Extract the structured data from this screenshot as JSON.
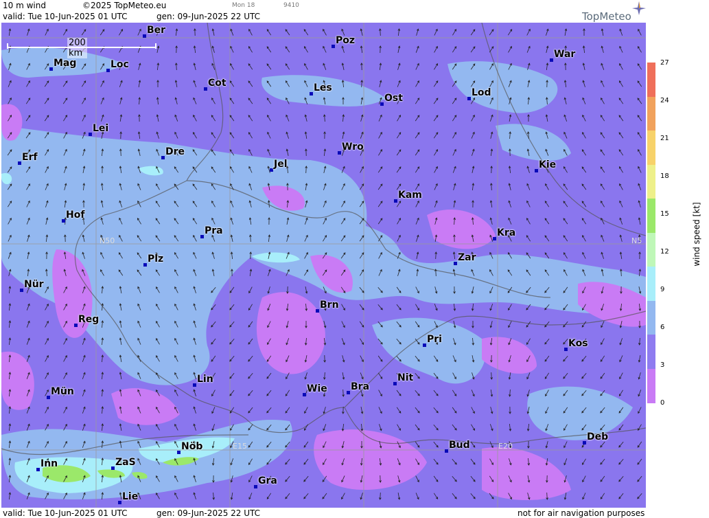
{
  "header": {
    "title": "10 m wind",
    "copyright": "©2025 TopMeteo.eu",
    "valid": "valid:  Tue  10-Jun-2025  01 UTC",
    "gen": "gen: 09-Jun-2025 22 UTC",
    "mon": "Mon 18",
    "code": "9410",
    "logo": "TopMeteo"
  },
  "map": {
    "scale_label": "200 km",
    "grid_labels": {
      "n50_left": "N50",
      "n50_right": "N5",
      "e15": "E15",
      "e20": "E20"
    },
    "cities": [
      {
        "name": "Ber"
      },
      {
        "name": "Poz"
      },
      {
        "name": "War"
      },
      {
        "name": "Mag"
      },
      {
        "name": "Loc"
      },
      {
        "name": "Cot"
      },
      {
        "name": "Les"
      },
      {
        "name": "Ost"
      },
      {
        "name": "Lod"
      },
      {
        "name": "Lei"
      },
      {
        "name": "Erf"
      },
      {
        "name": "Dre"
      },
      {
        "name": "Wro"
      },
      {
        "name": "Jel"
      },
      {
        "name": "Kie"
      },
      {
        "name": "Kam"
      },
      {
        "name": "Hof"
      },
      {
        "name": "Pra"
      },
      {
        "name": "Kra"
      },
      {
        "name": "Plz"
      },
      {
        "name": "Zar"
      },
      {
        "name": "Nür"
      },
      {
        "name": "Brn"
      },
      {
        "name": "Reg"
      },
      {
        "name": "Pri"
      },
      {
        "name": "Kos"
      },
      {
        "name": "Lin"
      },
      {
        "name": "Nit"
      },
      {
        "name": "Wie"
      },
      {
        "name": "Bra"
      },
      {
        "name": "Mün"
      },
      {
        "name": "Deb"
      },
      {
        "name": "Nöb"
      },
      {
        "name": "Bud"
      },
      {
        "name": "Inn"
      },
      {
        "name": "ZaS"
      },
      {
        "name": "Gra"
      },
      {
        "name": "Lie"
      }
    ]
  },
  "legend": {
    "title": "wind  speed  [kt]",
    "ticks": [
      "27",
      "24",
      "21",
      "18",
      "15",
      "12",
      "9",
      "6",
      "3",
      "0"
    ],
    "colors": [
      "#c97bf5",
      "#8f7cf0",
      "#93b8f0",
      "#a8eefa",
      "#bff7b8",
      "#9be86a",
      "#eef08a",
      "#f7d26a",
      "#f1a25c",
      "#ef6f5a"
    ]
  },
  "footer": {
    "valid": "valid:  Tue  10-Jun-2025  01 UTC",
    "gen": "gen: 09-Jun-2025 22 UTC",
    "note": "not for air navigation purposes"
  }
}
